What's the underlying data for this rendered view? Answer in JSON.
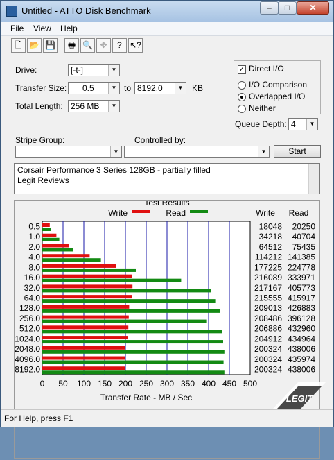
{
  "window": {
    "title": "Untitled - ATTO Disk Benchmark"
  },
  "titlebar_buttons": {
    "minimize": "–",
    "maximize": "□",
    "close": "✕"
  },
  "menu": [
    "File",
    "View",
    "Help"
  ],
  "toolbar": {
    "icons": [
      "new-icon",
      "open-icon",
      "save-icon",
      "print-icon",
      "print-preview-icon",
      "move-icon",
      "help-icon",
      "context-help-icon"
    ],
    "glyphs": [
      "🗋",
      "📂",
      "💾",
      "🖶",
      "🔍",
      "✥",
      "?",
      "↖?"
    ]
  },
  "form": {
    "drive_label": "Drive:",
    "drive_value": "[-t-]",
    "transfer_size_label": "Transfer Size:",
    "transfer_from": "0.5",
    "to_label": "to",
    "transfer_to": "8192.0",
    "kb_label": "KB",
    "total_length_label": "Total Length:",
    "total_length_value": "256 MB",
    "direct_io_label": "Direct I/O",
    "direct_io_checked": true,
    "io_comparison_label": "I/O Comparison",
    "overlapped_io_label": "Overlapped I/O",
    "neither_label": "Neither",
    "selected_mode": "Overlapped I/O",
    "queue_depth_label": "Queue Depth:",
    "queue_depth_value": "4",
    "stripe_group_label": "Stripe Group:",
    "stripe_group_value": "",
    "controlled_by_label": "Controlled by:",
    "controlled_by_value": "",
    "start_button": "Start",
    "description_line1": "Corsair Performance 3 Series 128GB - partially filled",
    "description_line2": "Legit Reviews"
  },
  "chart_data": {
    "type": "bar",
    "title": "Test Results",
    "xlabel": "Transfer Rate - MB / Sec",
    "xlim": [
      0,
      500
    ],
    "x_ticks": [
      "0",
      "50",
      "100",
      "150",
      "200",
      "250",
      "300",
      "350",
      "400",
      "450",
      "500"
    ],
    "legend": [
      "Write",
      "Read"
    ],
    "legend_position": "top",
    "column_headers": [
      "Write",
      "Read"
    ],
    "categories": [
      "0.5",
      "1.0",
      "2.0",
      "4.0",
      "8.0",
      "16.0",
      "32.0",
      "64.0",
      "128.0",
      "256.0",
      "512.0",
      "1024.0",
      "2048.0",
      "4096.0",
      "8192.0"
    ],
    "series": [
      {
        "name": "Write",
        "color": "#e01010",
        "values": [
          18,
          34,
          65,
          114,
          177,
          216,
          217,
          216,
          209,
          208,
          207,
          205,
          200,
          200,
          200
        ]
      },
      {
        "name": "Read",
        "color": "#138a13",
        "values": [
          20,
          41,
          75,
          141,
          225,
          334,
          406,
          416,
          427,
          396,
          433,
          435,
          438,
          436,
          438
        ]
      }
    ],
    "write_numbers": [
      "18048",
      "34218",
      "64512",
      "114212",
      "177225",
      "216089",
      "217167",
      "215555",
      "209013",
      "208486",
      "206886",
      "204912",
      "200324",
      "200324",
      "200324"
    ],
    "read_numbers": [
      "20250",
      "40704",
      "75435",
      "141385",
      "224778",
      "333971",
      "405773",
      "415917",
      "426883",
      "396128",
      "432960",
      "434964",
      "438006",
      "435974",
      "438006"
    ]
  },
  "status": {
    "text": "For Help, press F1"
  },
  "watermark": {
    "text": "LEGIT"
  },
  "colors": {
    "write": "#e01010",
    "read": "#138a13",
    "gridline": "#1a1aa8"
  }
}
